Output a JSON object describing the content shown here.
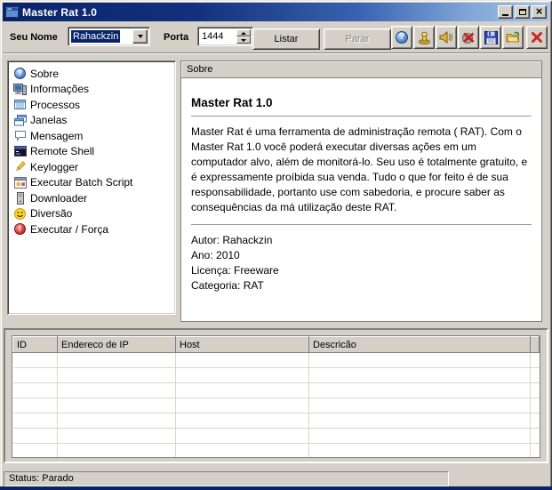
{
  "window": {
    "title": "Master Rat 1.0",
    "controls": [
      "minimize",
      "maximize",
      "close"
    ]
  },
  "toolbar": {
    "name_label": "Seu Nome",
    "name_value": "Rahackzin",
    "port_label": "Porta",
    "port_value": "1444",
    "listar_label": "Listar",
    "parar_label": "Parar",
    "icon_buttons": [
      "help-icon",
      "alarm-plunger-icon",
      "speaker-icon",
      "mute-icon",
      "save-icon",
      "open-folder-icon",
      "exit-icon"
    ]
  },
  "icons": {
    "help_glyph": "?",
    "alert_glyph": "!",
    "close_glyph": "×"
  },
  "sidebar": {
    "items": [
      {
        "label": "Sobre",
        "icon": "help-icon"
      },
      {
        "label": "Informações",
        "icon": "computer-icon"
      },
      {
        "label": "Processos",
        "icon": "list-icon"
      },
      {
        "label": "Janelas",
        "icon": "windows-icon"
      },
      {
        "label": "Mensagem",
        "icon": "speech-bubble-icon"
      },
      {
        "label": "Remote Shell",
        "icon": "console-icon"
      },
      {
        "label": "Keylogger",
        "icon": "pencil-icon"
      },
      {
        "label": "Executar Batch Script",
        "icon": "batch-window-icon"
      },
      {
        "label": "Downloader",
        "icon": "tower-pc-icon"
      },
      {
        "label": "Diversão",
        "icon": "smiley-icon"
      },
      {
        "label": "Executar / Força",
        "icon": "alert-icon"
      }
    ]
  },
  "content": {
    "header": "Sobre",
    "title": "Master Rat 1.0",
    "paragraph": "Master Rat é uma ferramenta de administração remota ( RAT). Com o Master Rat 1.0 você poderá executar diversas ações em um computador alvo, além de monitorá-lo. Seu uso é totalmente gratuito, e é expressamente proíbida sua venda. Tudo o que for feito é de sua responsabilidade, portanto use com sabedoria, e procure saber as consequências  da má utilização deste RAT.",
    "info_lines": [
      "Autor: Rahackzin",
      "Ano: 2010",
      "Licença: Freeware",
      "Categoria: RAT"
    ]
  },
  "table": {
    "columns": [
      "ID",
      "Endereco de IP",
      "Host",
      "Descricão"
    ],
    "rows": [],
    "empty_row_count": 8
  },
  "status_bar": {
    "text": "Status: Parado"
  }
}
